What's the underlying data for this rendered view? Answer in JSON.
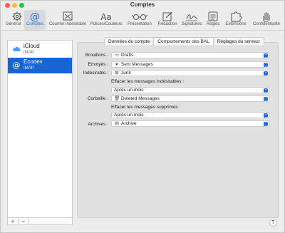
{
  "window": {
    "title": "Comptes"
  },
  "toolbar": {
    "items": [
      {
        "label": "Général",
        "icon": "gear-icon"
      },
      {
        "label": "Comptes",
        "icon": "at-icon"
      },
      {
        "label": "Courrier indésirable",
        "icon": "junk-tray-icon"
      },
      {
        "label": "Polices/Couleurs",
        "icon": "fonts-icon"
      },
      {
        "label": "Présentation",
        "icon": "glasses-icon"
      },
      {
        "label": "Rédaction",
        "icon": "compose-icon"
      },
      {
        "label": "Signatures",
        "icon": "signature-icon"
      },
      {
        "label": "Règles",
        "icon": "rules-icon"
      },
      {
        "label": "Extensions",
        "icon": "puzzle-icon"
      },
      {
        "label": "Confidentialité",
        "icon": "hand-icon"
      }
    ],
    "active": "Comptes",
    "accent": "#1a6ee8"
  },
  "accounts": [
    {
      "name": "iCloud",
      "type": "IMAP",
      "icon": "cloud-icon"
    },
    {
      "name": "Ecodev",
      "type": "IMAP",
      "icon": "at-icon",
      "selected": true
    }
  ],
  "sidebar_buttons": {
    "add": "+",
    "remove": "−"
  },
  "tabs": [
    {
      "label": "Données du compte"
    },
    {
      "label": "Comportements des BAL",
      "active": true
    },
    {
      "label": "Réglages du serveur"
    }
  ],
  "form": {
    "drafts_label": "Brouillons :",
    "drafts_value": "Drafts",
    "sent_label": "Envoyés :",
    "sent_value": "Sent Messages",
    "junk_label": "Indésirable :",
    "junk_value": "Junk",
    "junk_erase_label": "Effacer les messages indésirables :",
    "junk_erase_value": "Après un mois",
    "trash_label": "Corbeille :",
    "trash_value": "Deleted Messages",
    "deleted_erase_label": "Effacer les messages supprimés :",
    "deleted_erase_value": "Après un mois",
    "archive_label": "Archives :",
    "archive_value": "Archive"
  },
  "help": {
    "label": "?"
  }
}
